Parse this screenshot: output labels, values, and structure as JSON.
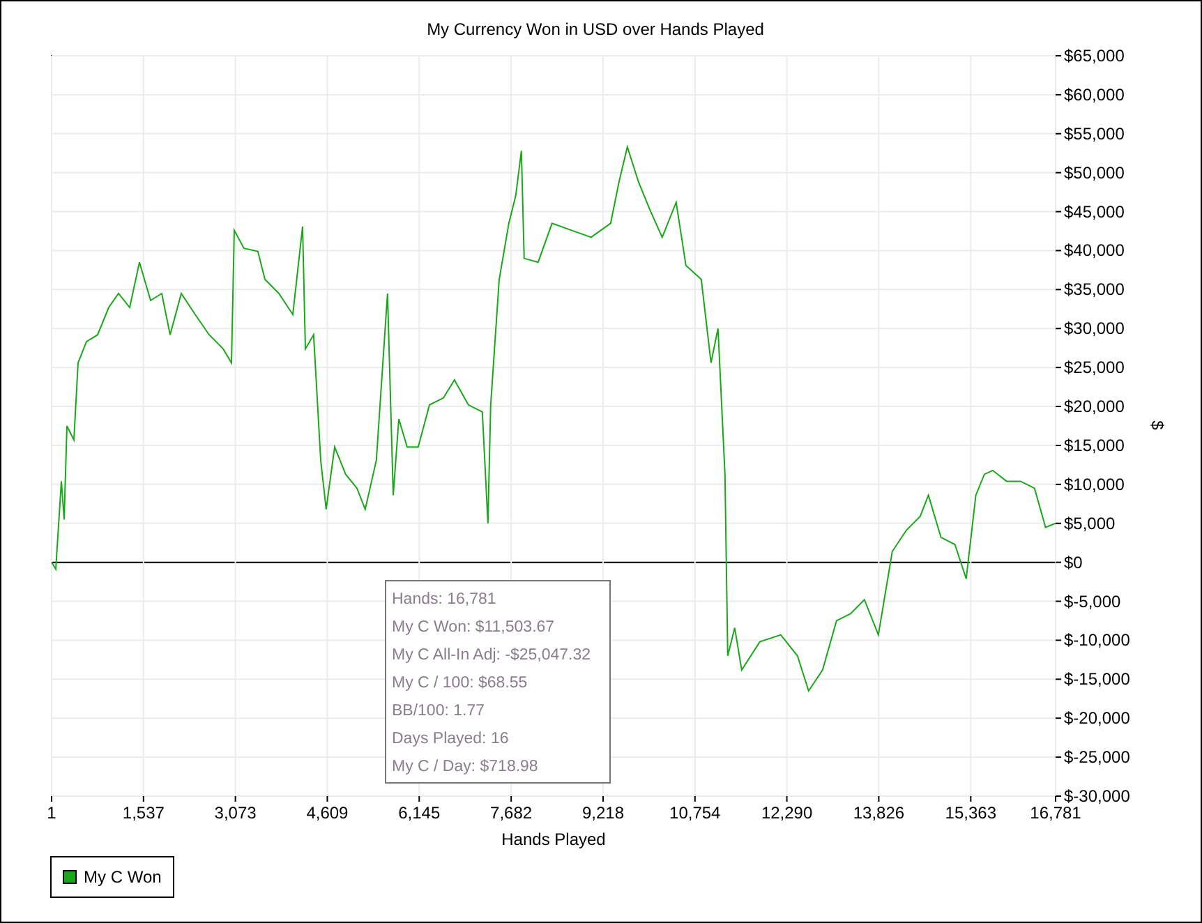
{
  "chart": {
    "tooltip": [
      "Hands: 16,781",
      "My C Won: $11,503.67",
      "My C All-In Adj: -$25,047.32",
      "My C / 100: $68.55",
      "BB/100: 1.77",
      "Days Played: 16",
      "My C / Day: $718.98"
    ],
    "chart_data": {
      "type": "line",
      "title": "My Currency Won in USD over Hands Played",
      "xlabel": "Hands Played",
      "ylabel": "$",
      "x": [
        1,
        71,
        164,
        211,
        257,
        374,
        444,
        584,
        770,
        956,
        1119,
        1306,
        1469,
        1655,
        1842,
        1982,
        2168,
        2401,
        2634,
        2867,
        3007,
        3053,
        3216,
        3449,
        3566,
        3799,
        4032,
        4195,
        4242,
        4381,
        4498,
        4591,
        4731,
        4917,
        5104,
        5243,
        5430,
        5616,
        5710,
        5803,
        5943,
        6129,
        6316,
        6549,
        6735,
        6968,
        7201,
        7294,
        7341,
        7481,
        7644,
        7760,
        7853,
        7900,
        8133,
        8366,
        8692,
        9018,
        9344,
        9484,
        9624,
        9810,
        9997,
        10206,
        10439,
        10602,
        10859,
        11022,
        11139,
        11255,
        11302,
        11418,
        11535,
        11838,
        12187,
        12467,
        12653,
        12886,
        13119,
        13352,
        13585,
        13818,
        14051,
        14284,
        14517,
        14656,
        14866,
        15099,
        15286,
        15449,
        15589,
        15729,
        15962,
        16195,
        16428,
        16614,
        16781
      ],
      "series": [
        {
          "name": "My C Won",
          "color": "#1aa81a",
          "values": [
            0,
            -900,
            10400,
            5500,
            17500,
            15700,
            25600,
            28300,
            29200,
            32700,
            34500,
            32700,
            38500,
            33600,
            34500,
            29200,
            34500,
            31800,
            29200,
            27400,
            25600,
            42600,
            40300,
            39900,
            36300,
            34500,
            31800,
            43100,
            27400,
            29200,
            13100,
            6800,
            14800,
            11300,
            9500,
            6800,
            13100,
            34500,
            8600,
            18400,
            14800,
            14800,
            20200,
            21100,
            23400,
            20200,
            19300,
            5000,
            20200,
            36300,
            43500,
            47100,
            52800,
            39000,
            38500,
            43500,
            42600,
            41700,
            43500,
            48800,
            53300,
            48800,
            45300,
            41700,
            46200,
            38100,
            36300,
            25600,
            30000,
            11300,
            -12000,
            -8400,
            -13800,
            -10200,
            -9300,
            -12000,
            -16500,
            -13800,
            -7500,
            -6600,
            -4800,
            -9300,
            1400,
            4100,
            5900,
            8600,
            3200,
            2300,
            -2100,
            8600,
            11300,
            11800,
            10400,
            10400,
            9500,
            4500,
            5000
          ]
        }
      ],
      "grid": true,
      "xlim": [
        1,
        16781
      ],
      "ylim": [
        -30000,
        65000
      ],
      "xticks": [
        {
          "value": 1,
          "label": "1"
        },
        {
          "value": 1537,
          "label": "1,537"
        },
        {
          "value": 3073,
          "label": "3,073"
        },
        {
          "value": 4609,
          "label": "4,609"
        },
        {
          "value": 6145,
          "label": "6,145"
        },
        {
          "value": 7682,
          "label": "7,682"
        },
        {
          "value": 9218,
          "label": "9,218"
        },
        {
          "value": 10754,
          "label": "10,754"
        },
        {
          "value": 12290,
          "label": "12,290"
        },
        {
          "value": 13826,
          "label": "13,826"
        },
        {
          "value": 15363,
          "label": "15,363"
        },
        {
          "value": 16781,
          "label": "16,781"
        }
      ],
      "yticks": [
        {
          "value": 65000,
          "label": "$65,000"
        },
        {
          "value": 60000,
          "label": "$60,000"
        },
        {
          "value": 55000,
          "label": "$55,000"
        },
        {
          "value": 50000,
          "label": "$50,000"
        },
        {
          "value": 45000,
          "label": "$45,000"
        },
        {
          "value": 40000,
          "label": "$40,000"
        },
        {
          "value": 35000,
          "label": "$35,000"
        },
        {
          "value": 30000,
          "label": "$30,000"
        },
        {
          "value": 25000,
          "label": "$25,000"
        },
        {
          "value": 20000,
          "label": "$20,000"
        },
        {
          "value": 15000,
          "label": "$15,000"
        },
        {
          "value": 10000,
          "label": "$10,000"
        },
        {
          "value": 5000,
          "label": "$5,000"
        },
        {
          "value": 0,
          "label": "$0"
        },
        {
          "value": -5000,
          "label": "$-5,000"
        },
        {
          "value": -10000,
          "label": "$-10,000"
        },
        {
          "value": -15000,
          "label": "$-15,000"
        },
        {
          "value": -20000,
          "label": "$-20,000"
        },
        {
          "value": -25000,
          "label": "$-25,000"
        },
        {
          "value": -30000,
          "label": "$-30,000"
        }
      ]
    }
  }
}
